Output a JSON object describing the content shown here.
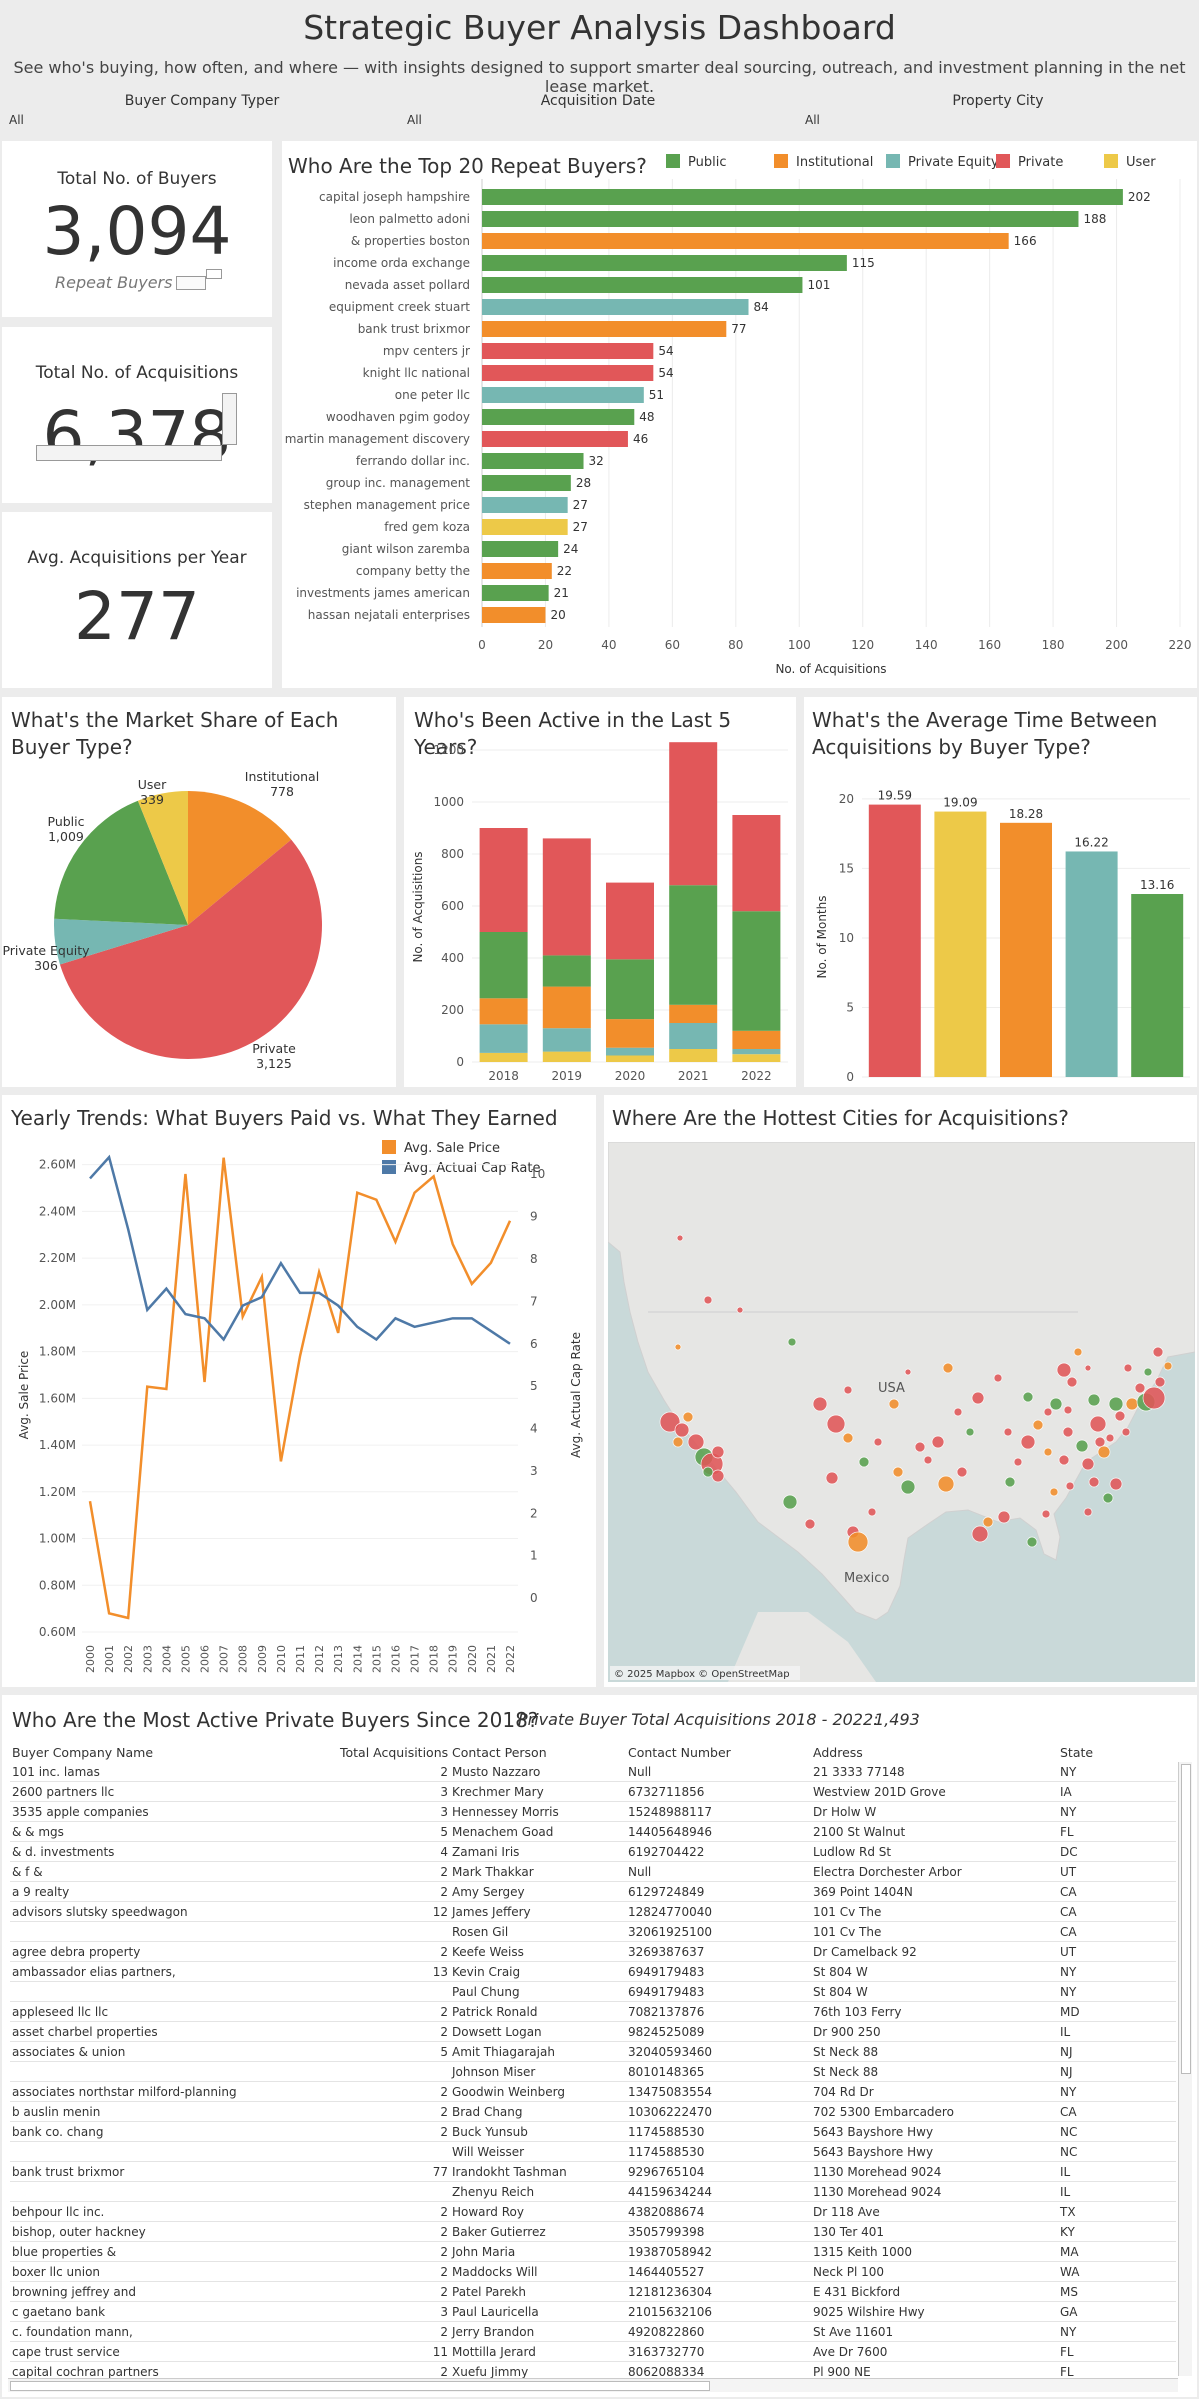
{
  "header": {
    "title": "Strategic Buyer Analysis Dashboard",
    "subtitle": "See who's buying, how often, and where — with insights designed to support smarter deal sourcing, outreach, and investment planning in the net lease market."
  },
  "filters": [
    {
      "label": "Buyer Company Typer",
      "value": "All"
    },
    {
      "label": "Acquisition Date",
      "value": "All"
    },
    {
      "label": "Property City",
      "value": "All"
    }
  ],
  "kpis": {
    "buyers": {
      "title": "Total No. of Buyers",
      "value": "3,094",
      "note": "Repeat Buyers"
    },
    "acquisitions": {
      "title": "Total No. of Acquisitions",
      "value": "6,378"
    },
    "per_year": {
      "title": "Avg. Acquisitions per Year",
      "value": "277"
    }
  },
  "colors": {
    "Public": "#59a14f",
    "Institutional": "#f28e2b",
    "Private Equity": "#76b7b2",
    "Private": "#e15759",
    "User": "#edc948"
  },
  "top_buyers": {
    "title": "Who Are the Top 20 Repeat Buyers?",
    "legend": [
      "Public",
      "Institutional",
      "Private Equity",
      "Private",
      "User"
    ],
    "chart_data": {
      "type": "bar",
      "orientation": "horizontal",
      "xlabel": "No. of Acquisitions",
      "xlim": [
        0,
        220
      ],
      "xticks": [
        0,
        20,
        40,
        60,
        80,
        100,
        120,
        140,
        160,
        180,
        200,
        220
      ],
      "bars": [
        {
          "name": "capital joseph hampshire",
          "value": 202,
          "type": "Public"
        },
        {
          "name": "leon palmetto adoni",
          "value": 188,
          "type": "Public"
        },
        {
          "name": "& properties boston",
          "value": 166,
          "type": "Institutional"
        },
        {
          "name": "income orda exchange",
          "value": 115,
          "type": "Public"
        },
        {
          "name": "nevada asset pollard",
          "value": 101,
          "type": "Public"
        },
        {
          "name": "equipment creek stuart",
          "value": 84,
          "type": "Private Equity"
        },
        {
          "name": "bank trust brixmor",
          "value": 77,
          "type": "Institutional"
        },
        {
          "name": "mpv centers jr",
          "value": 54,
          "type": "Private"
        },
        {
          "name": "knight llc national",
          "value": 54,
          "type": "Private"
        },
        {
          "name": "one peter llc",
          "value": 51,
          "type": "Private Equity"
        },
        {
          "name": "woodhaven pgim godoy",
          "value": 48,
          "type": "Public"
        },
        {
          "name": "martin management discovery",
          "value": 46,
          "type": "Private"
        },
        {
          "name": "ferrando dollar inc.",
          "value": 32,
          "type": "Public"
        },
        {
          "name": "group inc. management",
          "value": 28,
          "type": "Public"
        },
        {
          "name": "stephen management price",
          "value": 27,
          "type": "Private Equity"
        },
        {
          "name": "fred gem koza",
          "value": 27,
          "type": "User"
        },
        {
          "name": "giant wilson zaremba",
          "value": 24,
          "type": "Public"
        },
        {
          "name": "company betty the",
          "value": 22,
          "type": "Institutional"
        },
        {
          "name": "investments james american",
          "value": 21,
          "type": "Public"
        },
        {
          "name": "hassan nejatali enterprises",
          "value": 20,
          "type": "Institutional"
        }
      ]
    }
  },
  "market_share": {
    "title": "What's the Market Share of Each Buyer Type?",
    "chart_data": {
      "type": "pie",
      "slices": [
        {
          "name": "Institutional",
          "value": 778,
          "label": "778"
        },
        {
          "name": "Private",
          "value": 3125,
          "label": "3,125"
        },
        {
          "name": "Private Equity",
          "value": 306,
          "label": "306"
        },
        {
          "name": "Public",
          "value": 1009,
          "label": "1,009"
        },
        {
          "name": "User",
          "value": 339,
          "label": "339"
        }
      ]
    }
  },
  "active": {
    "title": "Who's Been Active in the Last 5 Years?",
    "chart_data": {
      "type": "bar",
      "stacked": true,
      "ylabel": "No. of Acquisitions",
      "ylim": [
        0,
        1250
      ],
      "yticks": [
        0,
        200,
        400,
        600,
        800,
        1000,
        1200
      ],
      "categories": [
        "2018",
        "2019",
        "2020",
        "2021",
        "2022"
      ],
      "series": [
        {
          "name": "User",
          "values": [
            35,
            40,
            25,
            50,
            30
          ]
        },
        {
          "name": "Private Equity",
          "values": [
            110,
            90,
            30,
            100,
            20
          ]
        },
        {
          "name": "Institutional",
          "values": [
            100,
            160,
            110,
            70,
            70
          ]
        },
        {
          "name": "Public",
          "values": [
            255,
            120,
            230,
            460,
            460
          ]
        },
        {
          "name": "Private",
          "values": [
            400,
            450,
            295,
            550,
            370
          ]
        }
      ]
    }
  },
  "avg_time": {
    "title": "What's the Average Time Between Acquisitions by Buyer Type?",
    "chart_data": {
      "type": "bar",
      "ylabel": "No. of Months",
      "ylim": [
        0,
        21
      ],
      "yticks": [
        0,
        5,
        10,
        15,
        20
      ],
      "bars": [
        {
          "name": "Private",
          "value": 19.59,
          "label": "19.59"
        },
        {
          "name": "User",
          "value": 19.09,
          "label": "19.09"
        },
        {
          "name": "Institutional",
          "value": 18.28,
          "label": "18.28"
        },
        {
          "name": "Private Equity",
          "value": 16.22,
          "label": "16.22"
        },
        {
          "name": "Public",
          "value": 13.16,
          "label": "13.16"
        }
      ]
    }
  },
  "trends": {
    "title": "Yearly Trends: What Buyers Paid vs. What They Earned",
    "legend": [
      "Avg. Sale Price",
      "Avg. Actual Cap Rate"
    ],
    "chart_data": {
      "type": "line",
      "ylabel": "Avg. Sale Price",
      "y2label": "Avg. Actual Cap Rate",
      "ylim": [
        0.6,
        2.65
      ],
      "yticks": [
        "0.60M",
        "0.80M",
        "1.00M",
        "1.20M",
        "1.40M",
        "1.60M",
        "1.80M",
        "2.00M",
        "2.20M",
        "2.40M",
        "2.60M"
      ],
      "y2lim": [
        -0.8,
        10.5
      ],
      "y2ticks": [
        0,
        1,
        2,
        3,
        4,
        5,
        6,
        7,
        8,
        9,
        10
      ],
      "x": [
        "2000",
        "2001",
        "2002",
        "2003",
        "2004",
        "2005",
        "2006",
        "2007",
        "2008",
        "2009",
        "2010",
        "2011",
        "2012",
        "2013",
        "2014",
        "2015",
        "2016",
        "2017",
        "2018",
        "2019",
        "2020",
        "2021",
        "2022"
      ],
      "series": [
        {
          "name": "Avg. Sale Price",
          "color": "#f28e2b",
          "values": [
            1.16,
            0.68,
            0.66,
            1.65,
            1.64,
            2.56,
            1.67,
            2.63,
            1.95,
            2.12,
            1.33,
            1.78,
            2.14,
            1.88,
            2.48,
            2.45,
            2.27,
            2.48,
            2.55,
            2.26,
            2.09,
            2.18,
            2.36
          ]
        },
        {
          "name": "Avg. Actual Cap Rate",
          "color": "#4e79a7",
          "values": [
            9.9,
            10.4,
            8.7,
            6.8,
            7.3,
            6.7,
            6.6,
            6.1,
            6.9,
            7.1,
            7.9,
            7.2,
            7.2,
            6.9,
            6.4,
            6.1,
            6.6,
            6.4,
            6.5,
            6.6,
            6.6,
            6.3,
            6.0
          ]
        }
      ]
    }
  },
  "map": {
    "title": "Where Are the Hottest Cities for Acquisitions?",
    "labels": {
      "usa": "USA",
      "mexico": "Mexico"
    },
    "attribution": "© 2025 Mapbox © OpenStreetMap"
  },
  "table": {
    "title": "Who Are the Most Active Private Buyers Since 2018?",
    "summary_label": "Private Buyer Total Acquisitions 2018 - 2022:",
    "summary_value": "1,493",
    "columns": [
      "Buyer Company Name",
      "Total Acquisitions",
      "Contact Person",
      "Contact Number",
      "Address",
      "State"
    ],
    "rows": [
      [
        "101 inc. lamas",
        "2",
        "Musto Nazzaro",
        "Null",
        "21 3333 77148",
        "NY"
      ],
      [
        "2600 partners llc",
        "3",
        "Krechmer Mary",
        "6732711856",
        "Westview 201D Grove",
        "IA"
      ],
      [
        "3535 apple companies",
        "3",
        "Hennessey Morris",
        "15248988117",
        "Dr Holw W",
        "NY"
      ],
      [
        "& & mgs",
        "5",
        "Menachem Goad",
        "14405648946",
        "2100 St Walnut",
        "FL"
      ],
      [
        "& d. investments",
        "4",
        "Zamani Iris",
        "6192704422",
        "Ludlow Rd St",
        "DC"
      ],
      [
        "& f &",
        "2",
        "Mark Thakkar",
        "Null",
        "Electra Dorchester Arbor",
        "UT"
      ],
      [
        "a 9 realty",
        "2",
        "Amy Sergey",
        "6129724849",
        "369 Point 1404N",
        "CA"
      ],
      [
        "advisors slutsky speedwagon",
        "12",
        "James Jeffery",
        "12824770040",
        "101 Cv The",
        "CA"
      ],
      [
        "",
        "",
        "Rosen Gil",
        "32061925100",
        "101 Cv The",
        "CA"
      ],
      [
        "agree debra property",
        "2",
        "Keefe Weiss",
        "3269387637",
        "Dr Camelback 92",
        "UT"
      ],
      [
        "ambassador elias partners,",
        "13",
        "Kevin Craig",
        "6949179483",
        "St 804 W",
        "NY"
      ],
      [
        "",
        "",
        "Paul Chung",
        "6949179483",
        "St 804 W",
        "NY"
      ],
      [
        "appleseed llc llc",
        "2",
        "Patrick Ronald",
        "7082137876",
        "76th 103 Ferry",
        "MD"
      ],
      [
        "asset charbel properties",
        "2",
        "Dowsett Logan",
        "9824525089",
        "Dr 900 250",
        "IL"
      ],
      [
        "associates & union",
        "5",
        "Amit Thiagarajah",
        "32040593460",
        "St Neck 88",
        "NJ"
      ],
      [
        "",
        "",
        "Johnson Miser",
        "8010148365",
        "St Neck 88",
        "NJ"
      ],
      [
        "associates northstar milford-planning",
        "2",
        "Goodwin Weinberg",
        "13475083554",
        "704 Rd Dr",
        "NY"
      ],
      [
        "b auslin menin",
        "2",
        "Brad Chang",
        "10306222470",
        "702 5300 Embarcadero",
        "CA"
      ],
      [
        "bank co. chang",
        "2",
        "Buck Yunsub",
        "1174588530",
        "5643 Bayshore Hwy",
        "NC"
      ],
      [
        "",
        "",
        "Will Weisser",
        "1174588530",
        "5643 Bayshore Hwy",
        "NC"
      ],
      [
        "bank trust brixmor",
        "77",
        "Irandokht Tashman",
        "9296765104",
        "1130 Morehead 9024",
        "IL"
      ],
      [
        "",
        "",
        "Zhenyu Reich",
        "44159634244",
        "1130 Morehead 9024",
        "IL"
      ],
      [
        "behpour llc inc.",
        "2",
        "Howard Roy",
        "4382088674",
        "Dr 118 Ave",
        "TX"
      ],
      [
        "bishop, outer hackney",
        "2",
        "Baker Gutierrez",
        "3505799398",
        "130 Ter 401",
        "KY"
      ],
      [
        "blue properties &",
        "2",
        "John Maria",
        "19387058942",
        "1315 Keith 1000",
        "MA"
      ],
      [
        "boxer llc union",
        "2",
        "Maddocks Will",
        "1464405527",
        "Neck Pl 100",
        "WA"
      ],
      [
        "browning jeffrey and",
        "2",
        "Patel Parekh",
        "12181236304",
        "E 431 Bickford",
        "MS"
      ],
      [
        "c gaetano bank",
        "3",
        "Paul Lauricella",
        "21015632106",
        "9025 Wilshire Hwy",
        "GA"
      ],
      [
        "c. foundation mann,",
        "2",
        "Jerry Brandon",
        "4920822860",
        "St Ave 11601",
        "NY"
      ],
      [
        "cape trust service",
        "11",
        "Mottilla Jerard",
        "3163732770",
        "Ave Dr 7600",
        "FL"
      ],
      [
        "capital cochran partners",
        "2",
        "Xuefu Jimmy",
        "8062088334",
        "Pl 900 NE",
        "FL"
      ]
    ]
  }
}
